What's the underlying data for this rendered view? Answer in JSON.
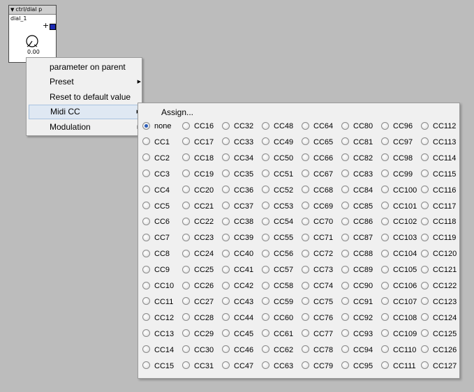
{
  "module": {
    "title": "ctrl/dial p",
    "name": "dial_1",
    "plus": "+",
    "value": "0.00"
  },
  "context_menu": {
    "items": [
      {
        "label": "parameter on parent",
        "submenu": false,
        "highlighted": false
      },
      {
        "label": "Preset",
        "submenu": true,
        "highlighted": false
      },
      {
        "label": "Reset to default value",
        "submenu": false,
        "highlighted": false
      },
      {
        "label": "Midi CC",
        "submenu": true,
        "highlighted": true
      },
      {
        "label": "Modulation",
        "submenu": true,
        "highlighted": false
      }
    ]
  },
  "midi_cc_menu": {
    "assign_label": "Assign...",
    "selected": "none",
    "columns": [
      [
        "none",
        "CC1",
        "CC2",
        "CC3",
        "CC4",
        "CC5",
        "CC6",
        "CC7",
        "CC8",
        "CC9",
        "CC10",
        "CC11",
        "CC12",
        "CC13",
        "CC14",
        "CC15"
      ],
      [
        "CC16",
        "CC17",
        "CC18",
        "CC19",
        "CC20",
        "CC21",
        "CC22",
        "CC23",
        "CC24",
        "CC25",
        "CC26",
        "CC27",
        "CC28",
        "CC29",
        "CC30",
        "CC31"
      ],
      [
        "CC32",
        "CC33",
        "CC34",
        "CC35",
        "CC36",
        "CC37",
        "CC38",
        "CC39",
        "CC40",
        "CC41",
        "CC42",
        "CC43",
        "CC44",
        "CC45",
        "CC46",
        "CC47"
      ],
      [
        "CC48",
        "CC49",
        "CC50",
        "CC51",
        "CC52",
        "CC53",
        "CC54",
        "CC55",
        "CC56",
        "CC57",
        "CC58",
        "CC59",
        "CC60",
        "CC61",
        "CC62",
        "CC63"
      ],
      [
        "CC64",
        "CC65",
        "CC66",
        "CC67",
        "CC68",
        "CC69",
        "CC70",
        "CC71",
        "CC72",
        "CC73",
        "CC74",
        "CC75",
        "CC76",
        "CC77",
        "CC78",
        "CC79"
      ],
      [
        "CC80",
        "CC81",
        "CC82",
        "CC83",
        "CC84",
        "CC85",
        "CC86",
        "CC87",
        "CC88",
        "CC89",
        "CC90",
        "CC91",
        "CC92",
        "CC93",
        "CC94",
        "CC95"
      ],
      [
        "CC96",
        "CC97",
        "CC98",
        "CC99",
        "CC100",
        "CC101",
        "CC102",
        "CC103",
        "CC104",
        "CC105",
        "CC106",
        "CC107",
        "CC108",
        "CC109",
        "CC110",
        "CC111"
      ],
      [
        "CC112",
        "CC113",
        "CC114",
        "CC115",
        "CC116",
        "CC117",
        "CC118",
        "CC119",
        "CC120",
        "CC121",
        "CC122",
        "CC123",
        "CC124",
        "CC125",
        "CC126",
        "CC127"
      ]
    ]
  },
  "colors": {
    "background": "#bcbcbc",
    "menu_background": "#f0f0f0",
    "highlight": "#dfe8f3",
    "radio_selected": "#2a5cb8",
    "module_indicator": "#1c2ab3"
  }
}
